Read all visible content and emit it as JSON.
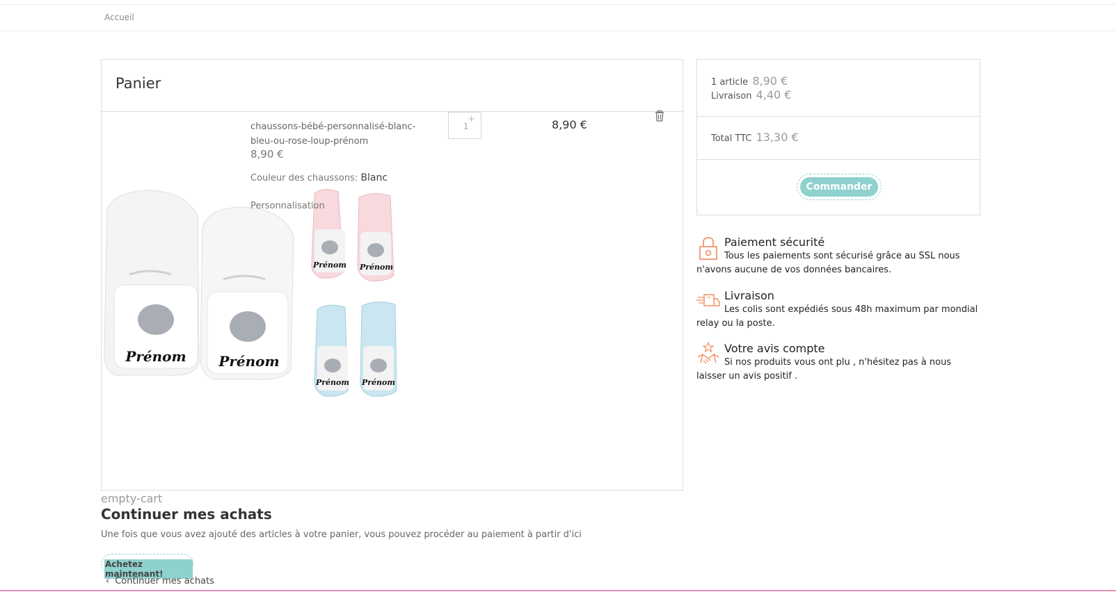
{
  "breadcrumb": {
    "home_label": "Accueil"
  },
  "cart": {
    "title": "Panier",
    "item": {
      "name": "chaussons-bébé-personnalisé-blanc-bleu-ou-rose-loup-prénom",
      "unit_price": "8,90 €",
      "attribute_label": "Couleur des chaussons:",
      "attribute_value": "Blanc",
      "personalisation_label": "Personnalisation",
      "quantity": "1",
      "total": "8,90 €",
      "image_labels": [
        "Prénom",
        "Prénom",
        "Prénom",
        "Prénom",
        "Prénom",
        "Prénom"
      ]
    }
  },
  "summary": {
    "items_label": "1 article",
    "items_value": "8,90 €",
    "shipping_label": "Livraison",
    "shipping_value": "4,40 €",
    "total_label": "Total TTC",
    "total_value": "13,30 €",
    "order_button": "Commander"
  },
  "reassurance": [
    {
      "icon": "padlock-icon",
      "title": "Paiement sécurité",
      "text": "Tous les paiements sont sécurisé grâce au SSL nous n'avons aucune de vos données bancaires."
    },
    {
      "icon": "delivery-truck-icon",
      "title": "Livraison",
      "text": "Les colis sont expédiés sous 48h maximum par mondial relay ou la poste."
    },
    {
      "icon": "handshake-star-icon",
      "title": "Votre avis compte",
      "text": "Si nos produits vous ont plu , n'hésitez pas à nous laisser un avis positif ."
    }
  ],
  "empty_cart": {
    "image_alt": "empty-cart",
    "title": "Continuer mes achats",
    "text": "Une fois que vous avez ajouté des articles à votre panier, vous pouvez procéder au paiement à partir d'ici",
    "buy_button": "Achetez maintenant!",
    "back_link": "Continuer mes achats"
  },
  "colors": {
    "accent": "#8fd1cd",
    "icon_orange": "#f08a5d",
    "bottom_line": "#e08fb6"
  }
}
